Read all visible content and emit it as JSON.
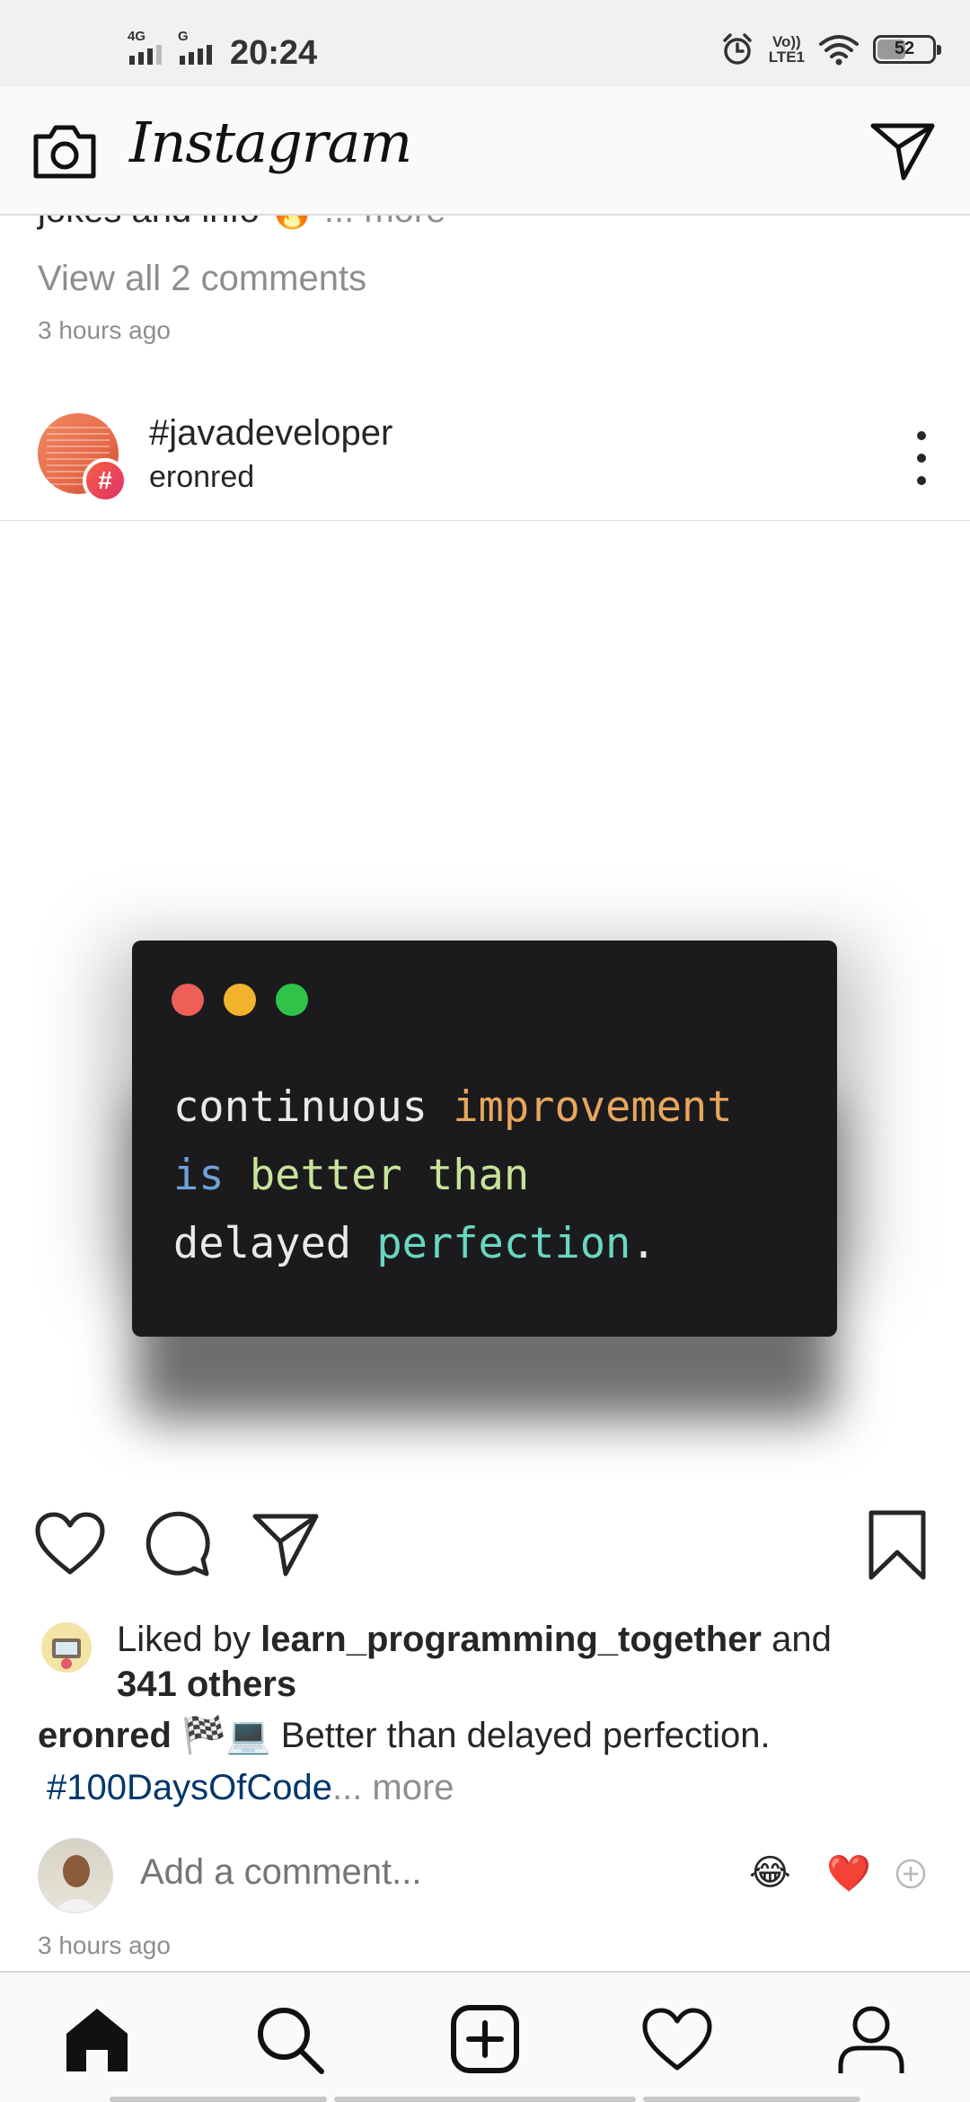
{
  "status_bar": {
    "net1": "4G",
    "net2": "G",
    "time": "20:24",
    "volte_top": "Vo))",
    "volte_bottom": "LTE1",
    "battery": "52",
    "battery_level": 0.52,
    "icons": [
      "signal-icon",
      "alarm-icon",
      "wifi-icon",
      "battery-icon"
    ]
  },
  "header": {
    "title": "Instagram",
    "left_icon": "camera-icon",
    "right_icon": "direct-message-icon"
  },
  "previous_post": {
    "caption_text": "jokes and info",
    "caption_emoji": "🔥",
    "caption_more": "... more",
    "view_comments": "View all 2 comments",
    "timestamp": "3 hours ago"
  },
  "post": {
    "title": "#javadeveloper",
    "subtitle": "eronred",
    "badge": "#",
    "image": {
      "line1_a": "continuous",
      "line1_b": "improvement",
      "line2_a": "is",
      "line2_b": "better than",
      "line3_a": "delayed",
      "line3_b": "perfection",
      "line3_c": ".",
      "colors": {
        "white": "#e9e9e9",
        "orange": "#e8a65d",
        "blue": "#6fa3d8",
        "green": "#c8e39b",
        "teal": "#69d7c2",
        "dot_red": "#ed5f57",
        "dot_yellow": "#f2b32c",
        "dot_green": "#2fc34a"
      }
    },
    "likes": {
      "prefix": "Liked by",
      "user": "learn_programming_together",
      "and": "and",
      "others": "341 others"
    },
    "caption": {
      "user": "eronred",
      "emojis": "🏁💻",
      "text": "Better than delayed perfection.",
      "hashtag": "#100DaysOfCode",
      "more": "... more"
    },
    "comment_placeholder": "Add a comment...",
    "quick_emojis": [
      "😂",
      "❤️"
    ],
    "timestamp": "3 hours ago"
  },
  "bottom_nav": {
    "items": [
      "home-icon",
      "search-icon",
      "new-post-icon",
      "activity-icon",
      "profile-icon"
    ]
  }
}
